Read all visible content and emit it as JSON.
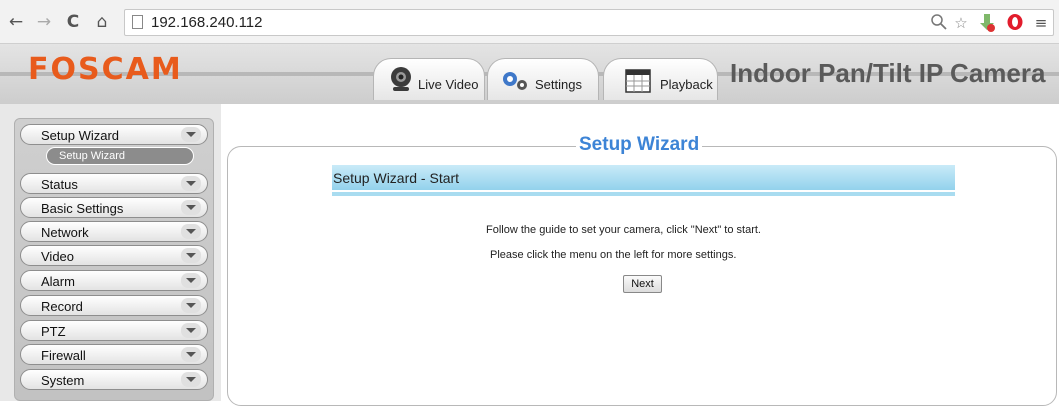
{
  "browser": {
    "back": "←",
    "forward": "→",
    "reload": "C",
    "home": "⌂",
    "url": "192.168.240.112",
    "icons": [
      "zoom-icon",
      "star-icon",
      "download-icon",
      "opera-icon",
      "menu-icon"
    ]
  },
  "header": {
    "logo": "FOSCAM",
    "product": "Indoor Pan/Tilt IP Camera",
    "tabs": [
      {
        "label": "Live Video",
        "icon": "webcam-icon"
      },
      {
        "label": "Settings",
        "icon": "gears-icon"
      },
      {
        "label": "Playback",
        "icon": "calendar-icon"
      }
    ]
  },
  "sidebar": {
    "items": [
      {
        "label": "Setup Wizard"
      },
      {
        "label": "Status"
      },
      {
        "label": "Basic Settings"
      },
      {
        "label": "Network"
      },
      {
        "label": "Video"
      },
      {
        "label": "Alarm"
      },
      {
        "label": "Record"
      },
      {
        "label": "PTZ"
      },
      {
        "label": "Firewall"
      },
      {
        "label": "System"
      }
    ],
    "submenu": {
      "label": "Setup Wizard"
    }
  },
  "content": {
    "title": "Setup Wizard",
    "section": "Setup Wizard - Start",
    "line1": "Follow the guide to set your camera, click \"Next\" to start.",
    "line2": "Please click the menu on the left for more settings.",
    "next_label": "Next"
  },
  "colors": {
    "logo": "#e85b1c",
    "title": "#3d84d6",
    "section_bar": "#93d2ec"
  }
}
